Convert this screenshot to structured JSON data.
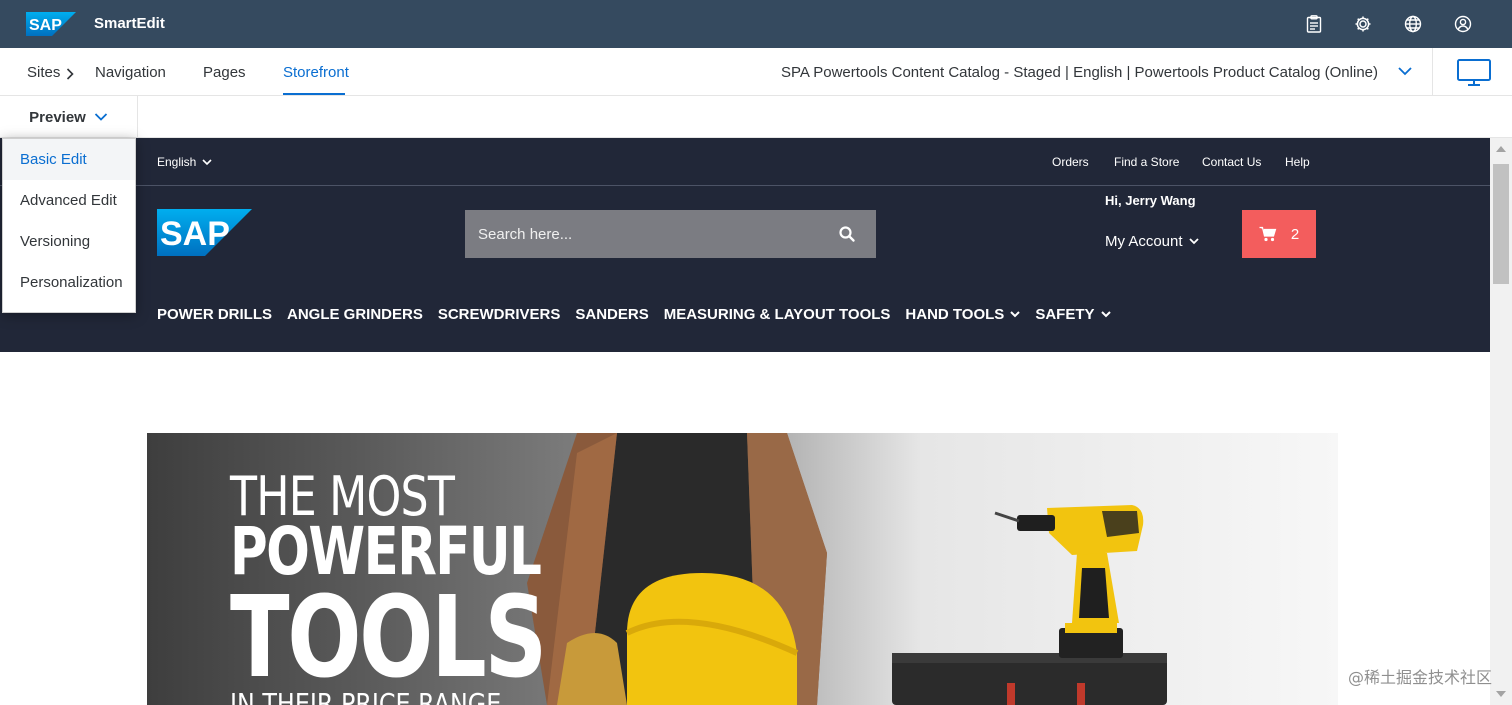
{
  "shell": {
    "logo_text": "SAP",
    "title": "SmartEdit",
    "icons": [
      "clipboard-icon",
      "gear-icon",
      "globe-icon",
      "user-icon"
    ]
  },
  "toolbar": {
    "breadcrumb": {
      "sites": "Sites",
      "navigation": "Navigation",
      "pages": "Pages",
      "storefront": "Storefront"
    },
    "catalog": "SPA Powertools Content Catalog - Staged | English | Powertools Product Catalog (Online)"
  },
  "preview": {
    "label": "Preview",
    "modes": [
      "Basic Edit",
      "Advanced Edit",
      "Versioning",
      "Personalization"
    ],
    "selected": "Basic Edit"
  },
  "storefront": {
    "language": "English",
    "links": {
      "orders": "Orders",
      "find_store": "Find a Store",
      "contact": "Contact Us",
      "help": "Help"
    },
    "logo_text": "SAP",
    "search_placeholder": "Search here...",
    "greeting": "Hi, Jerry Wang",
    "account": "My Account",
    "cart_count": "2",
    "nav": {
      "power_drills": "POWER DRILLS",
      "angle_grinders": "ANGLE GRINDERS",
      "screwdrivers": "SCREWDRIVERS",
      "sanders": "SANDERS",
      "measuring": "MEASURING & LAYOUT TOOLS",
      "hand_tools": "HAND TOOLS",
      "safety": "SAFETY"
    },
    "hero": {
      "line1": "THE MOST",
      "line2": "POWERFUL",
      "line3": "TOOLS",
      "line4": "IN THEIR PRICE RANGE"
    }
  },
  "colors": {
    "shell": "#354a5f",
    "accent": "#0a6ed1",
    "storefront_header": "#212738",
    "cart": "#f35d5d"
  },
  "watermark": "@稀土掘金技术社区"
}
